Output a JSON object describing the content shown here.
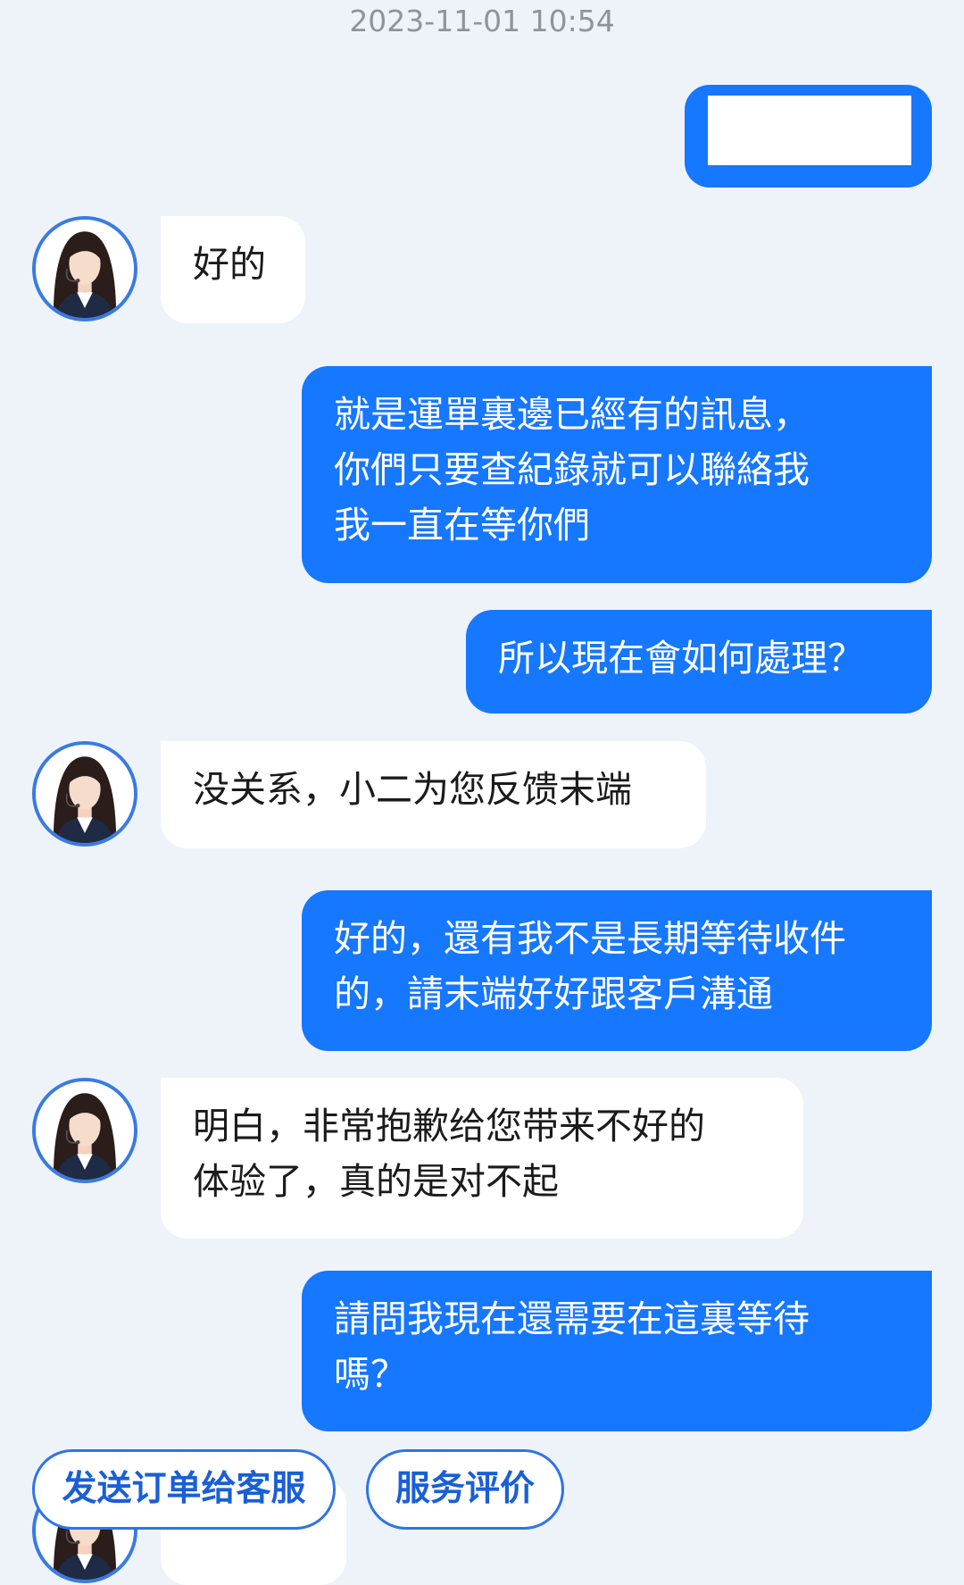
{
  "timestamp": "2023-11-01 10:54",
  "messages": [
    {
      "sender": "user",
      "text": "",
      "redacted": true
    },
    {
      "sender": "agent",
      "text": "好的"
    },
    {
      "sender": "user",
      "text": "就是運單裏邊已經有的訊息，\n你們只要查紀錄就可以聯絡我\n我一直在等你們"
    },
    {
      "sender": "user",
      "text": "所以現在會如何處理？"
    },
    {
      "sender": "agent",
      "text": "没关系，小二为您反馈末端"
    },
    {
      "sender": "user",
      "text": "好的，還有我不是長期等待收件\n的，請末端好好跟客戶溝通"
    },
    {
      "sender": "agent",
      "text": "明白，非常抱歉给您带来不好的\n体验了，真的是对不起"
    },
    {
      "sender": "user",
      "text": "請問我現在還需要在這裏等待\n嗎？"
    }
  ],
  "quick_actions": {
    "send_order": "发送订单给客服",
    "rate_service": "服务评价"
  },
  "colors": {
    "background": "#eef3fa",
    "user_bubble": "#1677ff",
    "agent_bubble": "#ffffff",
    "accent": "#2f74e8"
  },
  "icons": {
    "agent_avatar": "support-agent-avatar-icon"
  }
}
